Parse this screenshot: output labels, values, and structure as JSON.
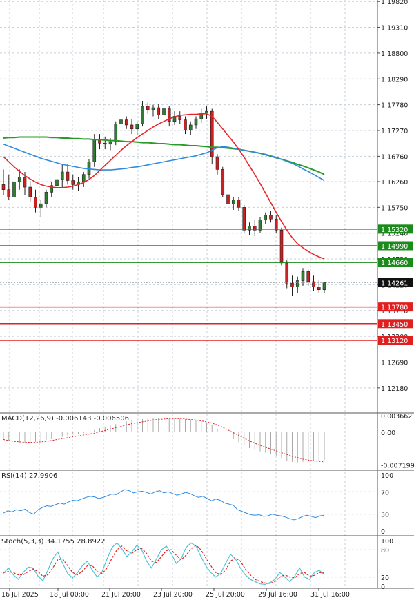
{
  "chart_data": [
    {
      "type": "candlestick",
      "panel": "price",
      "ylim": [
        1.117,
        1.1985
      ],
      "tick_labels": [
        "1.19820",
        "1.19310",
        "1.18800",
        "1.18290",
        "1.17780",
        "1.17270",
        "1.16760",
        "1.16260",
        "1.15750",
        "1.15240",
        "1.14730",
        "1.14220",
        "1.13710",
        "1.13200",
        "1.12690",
        "1.12180"
      ],
      "tick_values": [
        1.1982,
        1.1931,
        1.188,
        1.1829,
        1.1778,
        1.1727,
        1.1676,
        1.1626,
        1.1575,
        1.1524,
        1.1473,
        1.1422,
        1.1371,
        1.132,
        1.1269,
        1.1218
      ],
      "x_labels": [
        "16 Jul 2025",
        "18 Jul 00:00",
        "21 Jul 20:00",
        "23 Jul 20:00",
        "25 Jul 20:00",
        "29 Jul 16:00",
        "31 Jul 16:00"
      ],
      "colors": {
        "bull": "#2e7d32",
        "bear": "#cc2020",
        "ma_fast": "#e8262a",
        "ma_mid": "#2f8be0",
        "ma_slow": "#2a9a2a",
        "res_line": "#1c8a1c",
        "sup_line": "#e02020"
      },
      "current_price": {
        "value": 1.1426,
        "label": "1.14261"
      },
      "resistance_levels": [
        {
          "value": 1.1532,
          "label": "1.15320"
        },
        {
          "value": 1.1499,
          "label": "1.14990"
        },
        {
          "value": 1.1466,
          "label": "1.14660"
        }
      ],
      "support_levels": [
        {
          "value": 1.1378,
          "label": "1.13780"
        },
        {
          "value": 1.1345,
          "label": "1.13450"
        },
        {
          "value": 1.1312,
          "label": "1.13120"
        }
      ],
      "candles": [
        {
          "o": 1.162,
          "h": 1.165,
          "l": 1.16,
          "c": 1.161
        },
        {
          "o": 1.161,
          "h": 1.164,
          "l": 1.159,
          "c": 1.1595
        },
        {
          "o": 1.1595,
          "h": 1.168,
          "l": 1.156,
          "c": 1.1625
        },
        {
          "o": 1.1625,
          "h": 1.165,
          "l": 1.161,
          "c": 1.1635
        },
        {
          "o": 1.1635,
          "h": 1.1645,
          "l": 1.16,
          "c": 1.1615
        },
        {
          "o": 1.1615,
          "h": 1.1625,
          "l": 1.1585,
          "c": 1.1595
        },
        {
          "o": 1.1595,
          "h": 1.161,
          "l": 1.1565,
          "c": 1.1575
        },
        {
          "o": 1.1575,
          "h": 1.159,
          "l": 1.1555,
          "c": 1.1582
        },
        {
          "o": 1.1582,
          "h": 1.161,
          "l": 1.1575,
          "c": 1.1605
        },
        {
          "o": 1.1605,
          "h": 1.1625,
          "l": 1.1595,
          "c": 1.1618
        },
        {
          "o": 1.1618,
          "h": 1.164,
          "l": 1.1605,
          "c": 1.163
        },
        {
          "o": 1.163,
          "h": 1.166,
          "l": 1.1615,
          "c": 1.1645
        },
        {
          "o": 1.1645,
          "h": 1.166,
          "l": 1.162,
          "c": 1.1628
        },
        {
          "o": 1.1628,
          "h": 1.164,
          "l": 1.161,
          "c": 1.162
        },
        {
          "o": 1.162,
          "h": 1.1635,
          "l": 1.1608,
          "c": 1.1625
        },
        {
          "o": 1.1625,
          "h": 1.1645,
          "l": 1.1615,
          "c": 1.164
        },
        {
          "o": 1.164,
          "h": 1.167,
          "l": 1.1632,
          "c": 1.1665
        },
        {
          "o": 1.1665,
          "h": 1.172,
          "l": 1.1655,
          "c": 1.171
        },
        {
          "o": 1.171,
          "h": 1.172,
          "l": 1.169,
          "c": 1.1702
        },
        {
          "o": 1.1702,
          "h": 1.1715,
          "l": 1.169,
          "c": 1.17
        },
        {
          "o": 1.17,
          "h": 1.1712,
          "l": 1.1688,
          "c": 1.1705
        },
        {
          "o": 1.1705,
          "h": 1.1745,
          "l": 1.1698,
          "c": 1.174
        },
        {
          "o": 1.174,
          "h": 1.1758,
          "l": 1.1725,
          "c": 1.1748
        },
        {
          "o": 1.1748,
          "h": 1.1755,
          "l": 1.173,
          "c": 1.1738
        },
        {
          "o": 1.1738,
          "h": 1.175,
          "l": 1.172,
          "c": 1.173
        },
        {
          "o": 1.173,
          "h": 1.1745,
          "l": 1.1718,
          "c": 1.174
        },
        {
          "o": 1.174,
          "h": 1.1785,
          "l": 1.1735,
          "c": 1.1775
        },
        {
          "o": 1.1775,
          "h": 1.1782,
          "l": 1.176,
          "c": 1.1768
        },
        {
          "o": 1.1768,
          "h": 1.1778,
          "l": 1.1755,
          "c": 1.1772
        },
        {
          "o": 1.1772,
          "h": 1.178,
          "l": 1.175,
          "c": 1.1758
        },
        {
          "o": 1.1758,
          "h": 1.179,
          "l": 1.1745,
          "c": 1.177
        },
        {
          "o": 1.177,
          "h": 1.1775,
          "l": 1.1735,
          "c": 1.1745
        },
        {
          "o": 1.1745,
          "h": 1.1765,
          "l": 1.1738,
          "c": 1.1755
        },
        {
          "o": 1.1755,
          "h": 1.1765,
          "l": 1.174,
          "c": 1.1748
        },
        {
          "o": 1.1748,
          "h": 1.1755,
          "l": 1.172,
          "c": 1.1728
        },
        {
          "o": 1.1728,
          "h": 1.1745,
          "l": 1.1718,
          "c": 1.1738
        },
        {
          "o": 1.1738,
          "h": 1.1755,
          "l": 1.173,
          "c": 1.175
        },
        {
          "o": 1.175,
          "h": 1.177,
          "l": 1.1742,
          "c": 1.1762
        },
        {
          "o": 1.1762,
          "h": 1.1775,
          "l": 1.175,
          "c": 1.1765
        },
        {
          "o": 1.1765,
          "h": 1.177,
          "l": 1.166,
          "c": 1.1675
        },
        {
          "o": 1.1675,
          "h": 1.168,
          "l": 1.164,
          "c": 1.165
        },
        {
          "o": 1.165,
          "h": 1.1655,
          "l": 1.1595,
          "c": 1.16
        },
        {
          "o": 1.16,
          "h": 1.1605,
          "l": 1.1575,
          "c": 1.1582
        },
        {
          "o": 1.1582,
          "h": 1.1595,
          "l": 1.157,
          "c": 1.159
        },
        {
          "o": 1.159,
          "h": 1.1595,
          "l": 1.1568,
          "c": 1.1575
        },
        {
          "o": 1.1575,
          "h": 1.158,
          "l": 1.1525,
          "c": 1.153
        },
        {
          "o": 1.153,
          "h": 1.1545,
          "l": 1.152,
          "c": 1.1538
        },
        {
          "o": 1.1538,
          "h": 1.155,
          "l": 1.1518,
          "c": 1.153
        },
        {
          "o": 1.153,
          "h": 1.1555,
          "l": 1.1525,
          "c": 1.155
        },
        {
          "o": 1.155,
          "h": 1.1565,
          "l": 1.1542,
          "c": 1.156
        },
        {
          "o": 1.156,
          "h": 1.1568,
          "l": 1.1545,
          "c": 1.1552
        },
        {
          "o": 1.1552,
          "h": 1.156,
          "l": 1.1525,
          "c": 1.153
        },
        {
          "o": 1.153,
          "h": 1.1535,
          "l": 1.146,
          "c": 1.1465
        },
        {
          "o": 1.1465,
          "h": 1.147,
          "l": 1.1415,
          "c": 1.1425
        },
        {
          "o": 1.1425,
          "h": 1.144,
          "l": 1.14,
          "c": 1.1418
        },
        {
          "o": 1.1418,
          "h": 1.1438,
          "l": 1.1405,
          "c": 1.143
        },
        {
          "o": 1.143,
          "h": 1.1455,
          "l": 1.142,
          "c": 1.1448
        },
        {
          "o": 1.1448,
          "h": 1.1452,
          "l": 1.142,
          "c": 1.1428
        },
        {
          "o": 1.1428,
          "h": 1.144,
          "l": 1.141,
          "c": 1.1418
        },
        {
          "o": 1.1418,
          "h": 1.143,
          "l": 1.1405,
          "c": 1.1412
        },
        {
          "o": 1.1412,
          "h": 1.1428,
          "l": 1.1405,
          "c": 1.1426
        }
      ],
      "ma_slow": [
        1.1712,
        1.1713,
        1.1713,
        1.1714,
        1.1714,
        1.1714,
        1.1714,
        1.1714,
        1.1714,
        1.1713,
        1.1713,
        1.1712,
        1.1712,
        1.1711,
        1.1711,
        1.171,
        1.171,
        1.1709,
        1.1709,
        1.1708,
        1.1707,
        1.1707,
        1.1706,
        1.1705,
        1.1705,
        1.1704,
        1.1703,
        1.1703,
        1.1702,
        1.1701,
        1.1701,
        1.17,
        1.1699,
        1.1699,
        1.1698,
        1.1697,
        1.1697,
        1.1696,
        1.1695,
        1.1694,
        1.1694,
        1.1693,
        1.1692,
        1.1691,
        1.169,
        1.1688,
        1.1686,
        1.1684,
        1.1682,
        1.1679,
        1.1676,
        1.1673,
        1.167,
        1.1667,
        1.1664,
        1.166,
        1.1657,
        1.1653,
        1.1649,
        1.1645,
        1.164
      ],
      "ma_mid": [
        1.17,
        1.1696,
        1.1692,
        1.1688,
        1.1684,
        1.168,
        1.1676,
        1.1672,
        1.1669,
        1.1666,
        1.1663,
        1.166,
        1.1658,
        1.1656,
        1.1654,
        1.1652,
        1.1651,
        1.165,
        1.1649,
        1.1649,
        1.1649,
        1.165,
        1.1651,
        1.1652,
        1.1654,
        1.1655,
        1.1657,
        1.1659,
        1.1661,
        1.1663,
        1.1665,
        1.1667,
        1.1669,
        1.1671,
        1.1673,
        1.1675,
        1.1677,
        1.168,
        1.1683,
        1.1688,
        1.1693,
        1.1695,
        1.1694,
        1.1692,
        1.169,
        1.1688,
        1.1686,
        1.1684,
        1.1682,
        1.168,
        1.1677,
        1.1674,
        1.167,
        1.1666,
        1.1662,
        1.1657,
        1.1651,
        1.1646,
        1.164,
        1.1634,
        1.1628
      ],
      "ma_fast": [
        1.1675,
        1.1665,
        1.1655,
        1.1646,
        1.1638,
        1.1631,
        1.1625,
        1.162,
        1.1617,
        1.1615,
        1.1614,
        1.1614,
        1.1615,
        1.1617,
        1.162,
        1.1624,
        1.163,
        1.1638,
        1.1648,
        1.1658,
        1.1668,
        1.1678,
        1.1688,
        1.1697,
        1.1705,
        1.1713,
        1.172,
        1.1727,
        1.1734,
        1.174,
        1.1745,
        1.175,
        1.1754,
        1.1757,
        1.1758,
        1.1759,
        1.1759,
        1.176,
        1.176,
        1.1755,
        1.1743,
        1.173,
        1.1717,
        1.1704,
        1.169,
        1.1674,
        1.1657,
        1.164,
        1.1622,
        1.1603,
        1.1584,
        1.1565,
        1.1547,
        1.153,
        1.1515,
        1.1503,
        1.1495,
        1.1488,
        1.1482,
        1.1477,
        1.1473
      ]
    },
    {
      "type": "histogram",
      "panel": "macd",
      "label": "MACD(12,26,9) -0.006143 -0.006506",
      "ylim": [
        -0.0082,
        0.0041
      ],
      "tick_labels": [
        "0.003662",
        "0.00",
        "-0.007199"
      ],
      "tick_values": [
        0.003662,
        0.0,
        -0.007199
      ],
      "histogram": [
        -0.0015,
        -0.0019,
        -0.0022,
        -0.0023,
        -0.0023,
        -0.0022,
        -0.0021,
        -0.0019,
        -0.0017,
        -0.0015,
        -0.0012,
        -0.001,
        -0.0007,
        -0.0005,
        -0.0003,
        -0.0002,
        0.0,
        0.0005,
        0.0009,
        0.0012,
        0.0015,
        0.0018,
        0.0021,
        0.0024,
        0.0026,
        0.0028,
        0.0029,
        0.003,
        0.0031,
        0.0031,
        0.0032,
        0.0032,
        0.0031,
        0.003,
        0.0029,
        0.0028,
        0.0026,
        0.0024,
        0.0022,
        0.0016,
        0.0008,
        0.0001,
        -0.0007,
        -0.0015,
        -0.0022,
        -0.0029,
        -0.0035,
        -0.0039,
        -0.0042,
        -0.0045,
        -0.0048,
        -0.0052,
        -0.0058,
        -0.0063,
        -0.0065,
        -0.0066,
        -0.0065,
        -0.0064,
        -0.0063,
        -0.0062,
        -0.0061
      ],
      "signal": [
        -0.0016,
        -0.0018,
        -0.002,
        -0.0021,
        -0.0022,
        -0.0022,
        -0.0022,
        -0.0021,
        -0.002,
        -0.0018,
        -0.0016,
        -0.0014,
        -0.0012,
        -0.001,
        -0.0008,
        -0.0006,
        -0.0004,
        -0.0002,
        0.0001,
        0.0004,
        0.0007,
        0.001,
        0.0013,
        0.0016,
        0.0019,
        0.0021,
        0.0023,
        0.0025,
        0.0027,
        0.0028,
        0.0029,
        0.003,
        0.003,
        0.003,
        0.0029,
        0.0028,
        0.0027,
        0.0025,
        0.0023,
        0.002,
        0.0016,
        0.0011,
        0.0005,
        -0.0001,
        -0.0007,
        -0.0013,
        -0.0019,
        -0.0024,
        -0.0029,
        -0.0033,
        -0.0037,
        -0.0041,
        -0.0045,
        -0.0049,
        -0.0053,
        -0.0056,
        -0.0059,
        -0.0061,
        -0.0063,
        -0.0064,
        -0.0065
      ]
    },
    {
      "type": "line",
      "panel": "rsi",
      "label": "RSI(14) 27.9906",
      "ylim": [
        0,
        100
      ],
      "tick_labels": [
        "100",
        "70",
        "30",
        "0"
      ],
      "tick_values": [
        100,
        70,
        30,
        0
      ],
      "values": [
        32,
        36,
        34,
        38,
        36,
        39,
        33,
        30,
        38,
        42,
        45,
        44,
        47,
        50,
        48,
        52,
        55,
        54,
        57,
        60,
        62,
        61,
        58,
        60,
        63,
        66,
        65,
        70,
        74,
        72,
        68,
        70,
        71,
        69,
        66,
        70,
        72,
        68,
        70,
        67,
        64,
        66,
        69,
        67,
        63,
        60,
        62,
        58,
        54,
        57,
        55,
        50,
        48,
        46,
        38,
        35,
        32,
        29,
        28,
        29,
        26,
        27,
        30,
        28,
        27,
        25,
        22,
        20,
        22,
        26,
        28,
        26,
        24,
        27,
        28
      ]
    },
    {
      "type": "line",
      "panel": "stoch",
      "label": "Stoch(5,3,3) 34.1755 28.8922",
      "ylim": [
        0,
        100
      ],
      "tick_labels": [
        "100",
        "80",
        "20",
        "0"
      ],
      "tick_values": [
        100,
        80,
        20,
        0
      ],
      "main": [
        28,
        40,
        25,
        15,
        30,
        42,
        40,
        22,
        12,
        35,
        60,
        75,
        50,
        28,
        18,
        30,
        45,
        55,
        35,
        20,
        32,
        60,
        85,
        95,
        82,
        65,
        75,
        90,
        80,
        55,
        40,
        60,
        80,
        88,
        72,
        50,
        60,
        85,
        95,
        88,
        65,
        45,
        30,
        20,
        28,
        50,
        70,
        60,
        40,
        25,
        15,
        10,
        5,
        4,
        8,
        15,
        30,
        20,
        10,
        22,
        40,
        20,
        15,
        30,
        35,
        25
      ],
      "signal": [
        30,
        32,
        30,
        25,
        25,
        32,
        38,
        32,
        22,
        25,
        40,
        58,
        60,
        45,
        30,
        25,
        33,
        45,
        45,
        32,
        28,
        40,
        62,
        80,
        88,
        78,
        72,
        80,
        83,
        72,
        55,
        52,
        65,
        78,
        80,
        68,
        58,
        68,
        82,
        90,
        80,
        62,
        45,
        30,
        25,
        35,
        55,
        62,
        55,
        38,
        25,
        15,
        10,
        7,
        6,
        10,
        20,
        25,
        20,
        18,
        28,
        30,
        22,
        24,
        30,
        29
      ]
    }
  ]
}
